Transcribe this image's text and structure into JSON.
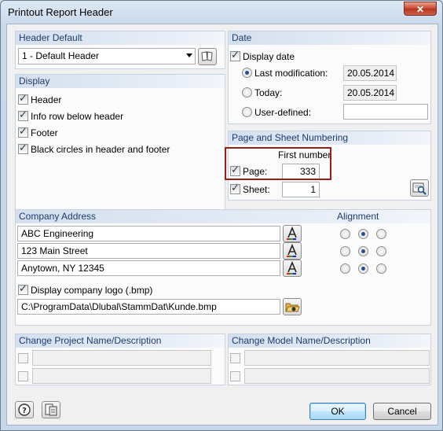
{
  "window": {
    "title": "Printout Report Header",
    "close_glyph": "✕"
  },
  "header_default": {
    "title": "Header Default",
    "selected": "1 - Default Header",
    "library_icon": "open-library-icon"
  },
  "display": {
    "title": "Display",
    "items": [
      {
        "label": "Header",
        "checked": true
      },
      {
        "label": "Info row below header",
        "checked": true
      },
      {
        "label": "Footer",
        "checked": true
      },
      {
        "label": "Black circles in header and footer",
        "checked": true
      }
    ]
  },
  "date": {
    "title": "Date",
    "display_date_label": "Display date",
    "options": [
      {
        "label": "Last modification:",
        "value": "20.05.2014",
        "selected": true
      },
      {
        "label": "Today:",
        "value": "20.05.2014",
        "selected": false
      },
      {
        "label": "User-defined:",
        "value": "",
        "selected": false
      }
    ]
  },
  "numbering": {
    "title": "Page and Sheet Numbering",
    "first_number_label": "First number",
    "page_label": "Page:",
    "page_value": "333",
    "sheet_label": "Sheet:",
    "sheet_value": "1",
    "preview_icon": "preview-icon"
  },
  "company": {
    "title": "Company Address",
    "alignment_title": "Alignment",
    "lines": [
      {
        "value": "ABC Engineering",
        "alignment": "center"
      },
      {
        "value": "123 Main Street",
        "alignment": "center"
      },
      {
        "value": "Anytown, NY 12345",
        "alignment": "center"
      }
    ],
    "logo_label": "Display company logo (.bmp)",
    "logo_path": "C:\\ProgramData\\Dlubal\\StammDat\\Kunde.bmp"
  },
  "change_project": {
    "title": "Change Project Name/Description"
  },
  "change_model": {
    "title": "Change Model Name/Description"
  },
  "buttons": {
    "ok": "OK",
    "cancel": "Cancel"
  },
  "colors": {
    "accent_border": "#9e1b1b",
    "panel_header_text": "#1e3b6e"
  }
}
